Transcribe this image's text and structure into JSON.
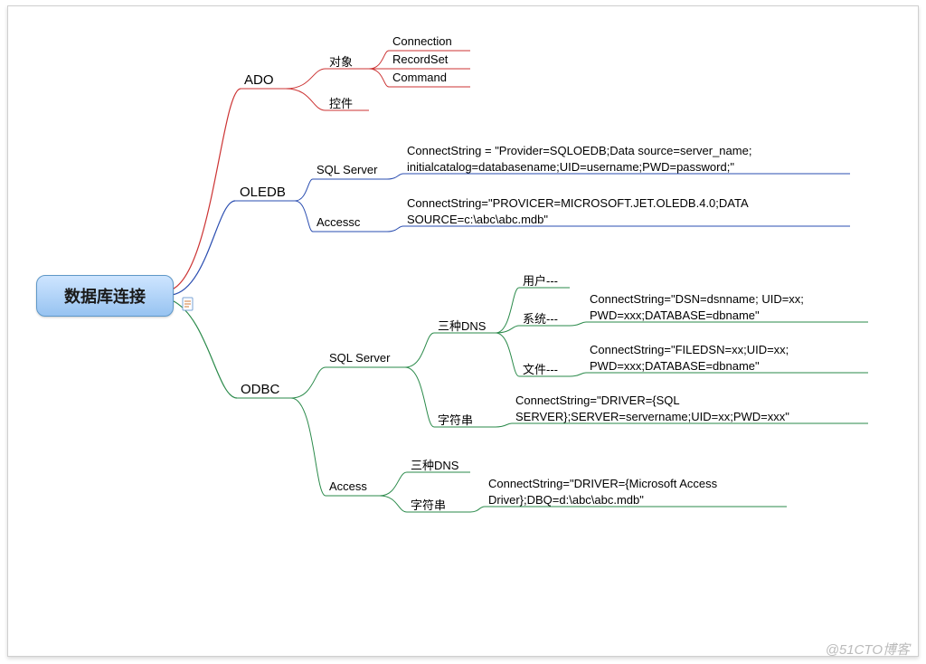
{
  "root": "数据库连接",
  "watermark": "@51CTO博客",
  "ado": {
    "title": "ADO",
    "object": "对象",
    "connection": "Connection",
    "recordset": "RecordSet",
    "command": "Command",
    "control": "控件"
  },
  "oledb": {
    "title": "OLEDB",
    "sqlserver": "SQL Server",
    "sqlconn": "ConnectString =  \"Provider=SQLOEDB;Data source=server_name; initialcatalog=databasename;UID=username;PWD=password;\"",
    "access": "Accessc",
    "accconn": "ConnectString=\"PROVICER=MICROSOFT.JET.OLEDB.4.0;DATA SOURCE=c:\\abc\\abc.mdb\""
  },
  "odbc": {
    "title": "ODBC",
    "sqlserver": "SQL Server",
    "dns": "三种DNS",
    "user": "用户---",
    "system": "系统---",
    "file": "文件---",
    "sysconn": "ConnectString=\"DSN=dsnname; UID=xx; PWD=xxx;DATABASE=dbname\"",
    "fileconn": "ConnectString=\"FILEDSN=xx;UID=xx; PWD=xxx;DATABASE=dbname\"",
    "string": "字符串",
    "strconn": "ConnectString=\"DRIVER={SQL SERVER};SERVER=servername;UID=xx;PWD=xxx\"",
    "access": "Access",
    "adns": "三种DNS",
    "astring": "字符串",
    "astrconn": "ConnectString=\"DRIVER={Microsoft Access Driver};DBQ=d:\\abc\\abc.mdb\""
  }
}
